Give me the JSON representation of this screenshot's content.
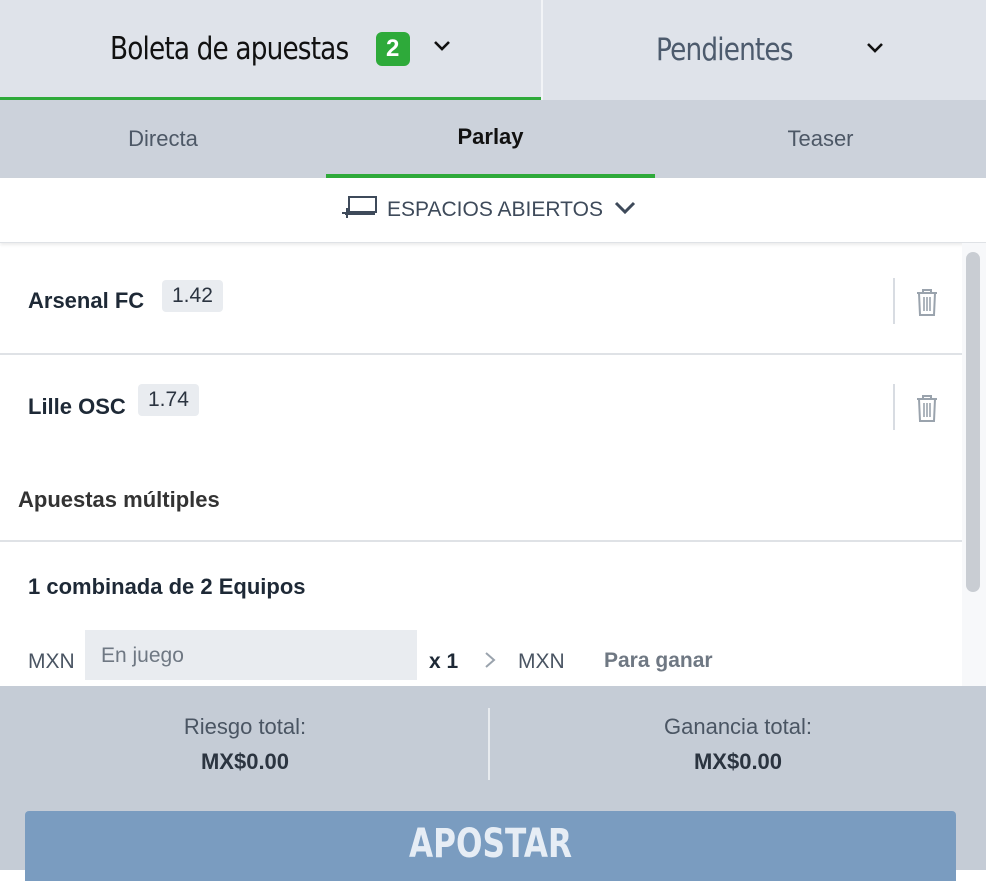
{
  "header": {
    "betslip_label": "Boleta de apuestas",
    "betslip_count": "2",
    "pending_label": "Pendientes"
  },
  "bet_types": {
    "tabs": [
      {
        "label": "Directa",
        "active": false
      },
      {
        "label": "Parlay",
        "active": true
      },
      {
        "label": "Teaser",
        "active": false
      }
    ]
  },
  "open_spaces": {
    "label": "ESPACIOS ABIERTOS"
  },
  "selections": [
    {
      "team": "Arsenal FC",
      "odds": "1.42"
    },
    {
      "team": "Lille OSC",
      "odds": "1.74"
    }
  ],
  "multiples": {
    "title": "Apuestas múltiples",
    "combo_title": "1 combinada de 2 Equipos",
    "stake_currency": "MXN",
    "stake_placeholder": "En juego",
    "multiplier": "x 1",
    "win_currency": "MXN",
    "to_win_label": "Para ganar"
  },
  "totals": {
    "risk_label": "Riesgo total:",
    "risk_value": "MX$0.00",
    "gain_label": "Ganancia total:",
    "gain_value": "MX$0.00"
  },
  "actions": {
    "place_bet_label": "APOSTAR"
  },
  "colors": {
    "accent": "#2eaa3a",
    "button": "#7a9cc0",
    "header_bg": "#dfe3ea",
    "tabs_bg": "#ccd2db",
    "totals_bg": "#c5ccd6"
  }
}
